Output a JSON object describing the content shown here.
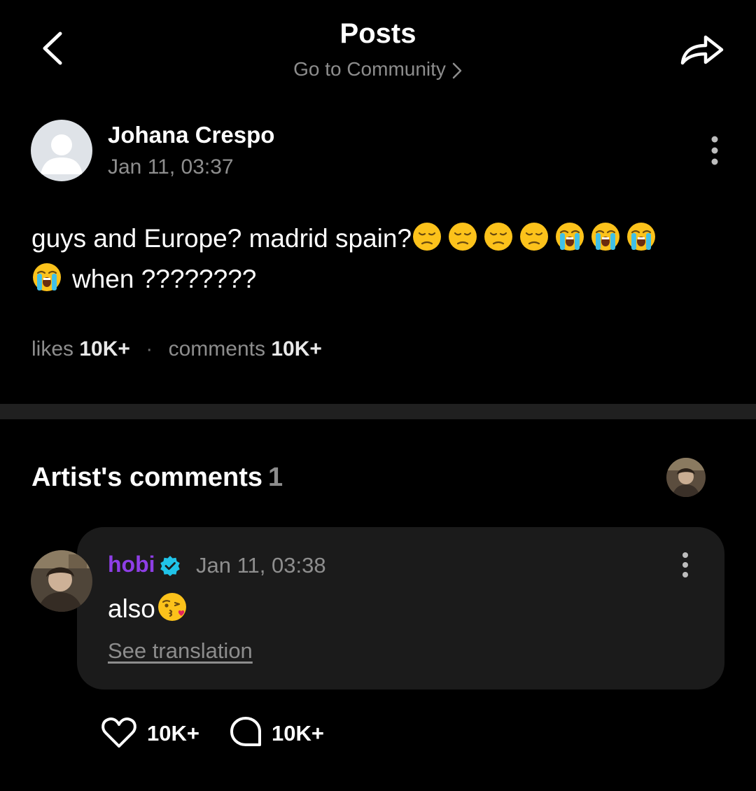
{
  "header": {
    "title": "Posts",
    "community_link": "Go to Community",
    "back_icon": "chevron-left-icon",
    "share_icon": "share-arrow-icon"
  },
  "post": {
    "author_name": "Johana Crespo",
    "date": "Jan 11, 03:37",
    "line1_text": "guys and Europe? madrid spain?",
    "line2_text": "when ????????",
    "emojis_line1": [
      "pensive-face",
      "pensive-face",
      "pensive-face",
      "pensive-face",
      "loudly-crying-face",
      "loudly-crying-face",
      "loudly-crying-face"
    ],
    "emojis_line2": [
      "loudly-crying-face"
    ],
    "stats": {
      "likes_label": "likes",
      "likes_value": "10K+",
      "comments_label": "comments",
      "comments_value": "10K+"
    }
  },
  "artist_comments": {
    "title": "Artist's comments",
    "count": "1",
    "comment": {
      "author": "hobi",
      "verified": true,
      "date": "Jan 11, 03:38",
      "text": "also",
      "emoji": "face-blowing-a-kiss",
      "see_translation": "See translation",
      "like_count": "10K+",
      "reply_count": "10K+"
    }
  },
  "colors": {
    "background": "#000000",
    "secondary_text": "#8d8d8d",
    "card_background": "#1b1b1b",
    "divider": "#202020",
    "artist_name": "#8e3ee6",
    "verified_badge": "#20c3e8"
  }
}
